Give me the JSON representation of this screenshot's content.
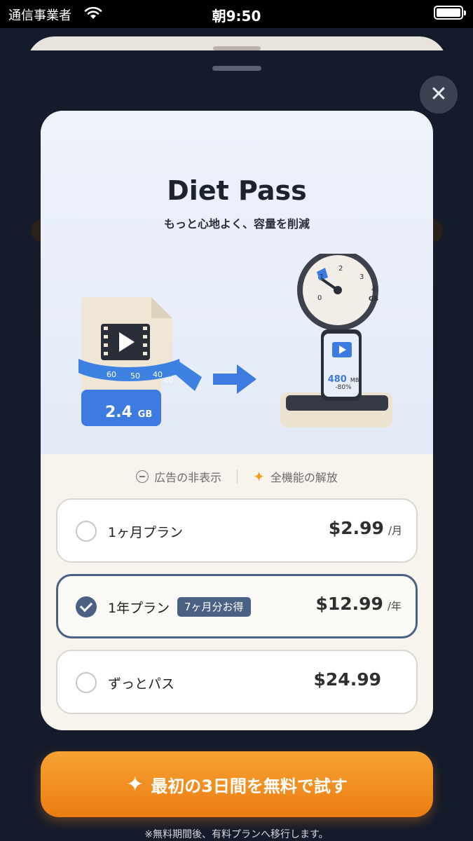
{
  "status_bar": {
    "carrier": "通信事業者",
    "time": "朝9:50"
  },
  "header": {
    "close_icon": "close-icon"
  },
  "hero": {
    "title": "Diet Pass",
    "subtitle": "もっと心地よく、容量を削減",
    "before_size": "2.4",
    "before_unit": "GB",
    "after_size": "480",
    "after_unit": "MB",
    "reduction": "-80%",
    "tape_marks": [
      "60",
      "50",
      "40",
      "40"
    ],
    "gauge_marks": [
      "0",
      "1",
      "2",
      "3",
      "4",
      "GB"
    ]
  },
  "features": [
    {
      "label": "広告の非表示",
      "icon": "minus-circle-icon"
    },
    {
      "label": "全機能の解放",
      "icon": "sparkle-icon"
    }
  ],
  "plans": [
    {
      "name": "1ヶ月プラン",
      "price": "$2.99",
      "unit": "/月",
      "selected": false
    },
    {
      "name": "1年プラン",
      "badge": "7ヶ月分お得",
      "price": "$12.99",
      "unit": "/年",
      "selected": true
    },
    {
      "name": "ずっとパス",
      "price": "$24.99",
      "unit": "",
      "selected": false
    }
  ],
  "cta": {
    "label": "最初の3日間を無料で試す",
    "icon": "sparkle-icon"
  },
  "footnote": "※無料期間後、有料プランへ移行します。",
  "colors": {
    "accent": "#4a6185",
    "cta": "#ec7d12",
    "background": "#141b2b"
  }
}
